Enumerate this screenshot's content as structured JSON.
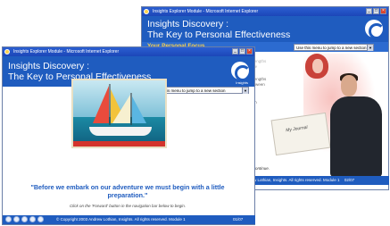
{
  "back_window": {
    "title": "Insights Explorer Module - Microsoft Internet Explorer",
    "app_title_1": "Insights Discovery :",
    "app_title_2": "The Key to Personal Effectiveness",
    "section": "Your Personal Focus",
    "jump_menu": "Use this menu to jump to a new section",
    "body_partial": [
      "...strengths",
      "...able",
      "...strengths",
      "...between",
      "...d",
      "...with my",
      "...d then"
    ],
    "goto_text": "Go to the next page to continue.",
    "footer_text": "w Lothian, Insights. All rights reserved.   Module 1",
    "page": "02/07",
    "card_text": "My Journal"
  },
  "front_window": {
    "title": "Insights Explorer Module - Microsoft Internet Explorer",
    "app_title_1": "Insights Discovery :",
    "app_title_2": "The Key to Personal Effectiveness",
    "logo_text": "Insights",
    "jump_menu": "Use this menu to jump to a new section",
    "quote": "\"Before we embark on our adventure we must begin with a little preparation.\"",
    "hint": "Click on the 'Forward' button in the navigation bar below to begin.",
    "copyright": "© Copyright 2003 Andrew Lothian, Insights. All rights reserved.   Module 1",
    "page": "01/07"
  }
}
